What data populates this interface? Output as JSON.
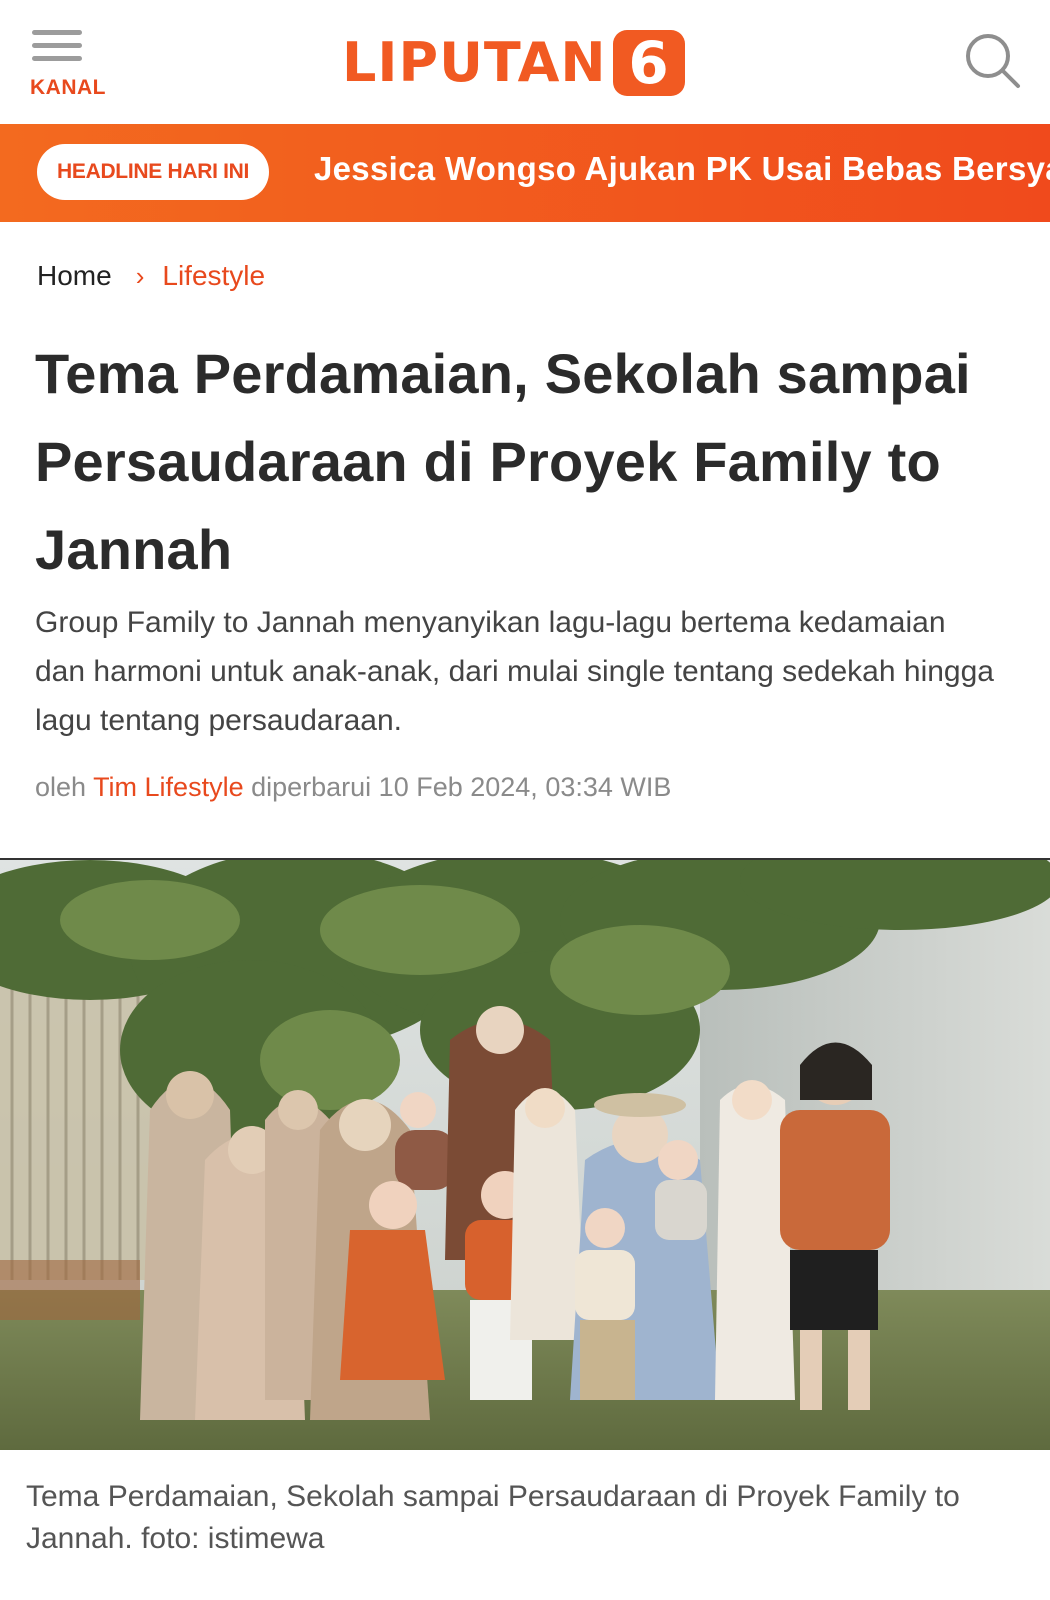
{
  "header": {
    "menu_label": "KANAL",
    "logo_text": "LIPUTAN",
    "logo_number": "6",
    "brand_color": "#f15a22"
  },
  "headline_bar": {
    "pill_label": "HEADLINE HARI INI",
    "headline": "Jessica Wongso Ajukan PK Usai Bebas Bersyarat"
  },
  "breadcrumb": {
    "home": "Home",
    "separator": "›",
    "current": "Lifestyle"
  },
  "article": {
    "title": "Tema Perdamaian, Sekolah sampai Persaudaraan di Proyek Family to Jannah",
    "lead": "Group Family to Jannah menyanyikan lagu-lagu bertema kedamaian dan harmoni untuk anak-anak, dari mulai single tentang sedekah hingga lagu tentang persaudaraan.",
    "meta_prefix": "oleh",
    "author": "Tim Lifestyle",
    "meta_updated": "diperbarui 10 Feb 2024, 03:34 WIB",
    "caption": "Tema Perdamaian, Sekolah sampai Persaudaraan di Proyek Family to Jannah.  foto: istimewa"
  },
  "icons": {
    "menu": "hamburger-icon",
    "search": "search-icon"
  }
}
